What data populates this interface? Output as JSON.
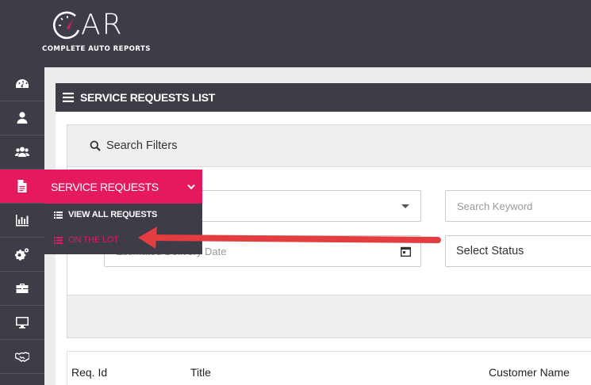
{
  "brand": {
    "logo_text": "AR",
    "tagline": "COMPLETE AUTO REPORTS",
    "accent_color": "#e5195f",
    "dark_color": "#3d3c47"
  },
  "sidebar": {
    "items": [
      {
        "icon": "dashboard-icon"
      },
      {
        "icon": "user-icon"
      },
      {
        "icon": "users-icon"
      },
      {
        "icon": "document-icon",
        "active": true
      },
      {
        "icon": "bar-chart-icon"
      },
      {
        "icon": "gears-icon"
      },
      {
        "icon": "briefcase-icon"
      },
      {
        "icon": "monitor-icon"
      },
      {
        "icon": "handshake-icon"
      }
    ]
  },
  "flyout": {
    "title": "SERVICE REQUESTS",
    "items": [
      {
        "label": "VIEW ALL REQUESTS",
        "icon": "list-icon"
      },
      {
        "label": "ON THE LOT",
        "icon": "list-icon"
      }
    ]
  },
  "panel": {
    "title": "SERVICE REQUESTS LIST"
  },
  "filters": {
    "title": "Search Filters",
    "keyword_placeholder": "Search Keyword",
    "date_placeholder": "Estimated Delivery Date",
    "status_value": "Select Status"
  },
  "table": {
    "columns": [
      "Req. Id",
      "Title",
      "Customer Name"
    ]
  }
}
